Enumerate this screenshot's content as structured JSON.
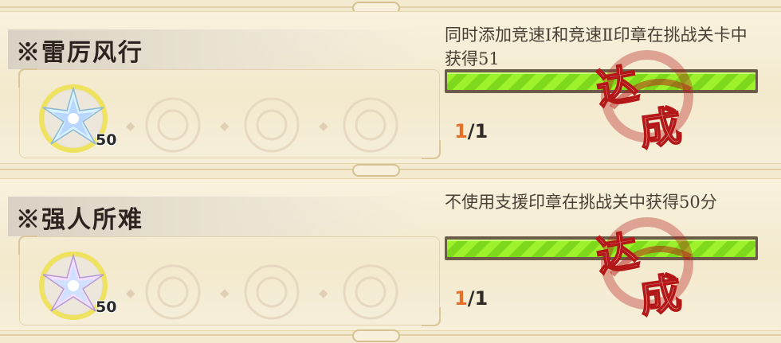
{
  "achievements": [
    {
      "title": "※雷厉风行",
      "description": "同时添加竞速Ⅰ和竞速Ⅱ印章在挑战关卡中获得51",
      "reward_count": "50",
      "progress_current": "1",
      "progress_total": "/1",
      "progress_fraction": 1,
      "stamp_chars": [
        "达",
        "成"
      ]
    },
    {
      "title": "※强人所难",
      "description": "不使用支援印章在挑战关中获得50分",
      "reward_count": "50",
      "progress_current": "1",
      "progress_total": "/1",
      "progress_fraction": 1,
      "stamp_chars": [
        "达",
        "成"
      ]
    }
  ],
  "colors": {
    "progress_green": "#9ef22c",
    "progress_orange": "#e86f2a",
    "stamp_red": "#b41718"
  },
  "icons": {
    "reward": "star-crystal-icon",
    "empty_slot": "empty-slot-icon",
    "diamond": "diamond-icon",
    "stamp": "achieved-stamp-icon"
  }
}
